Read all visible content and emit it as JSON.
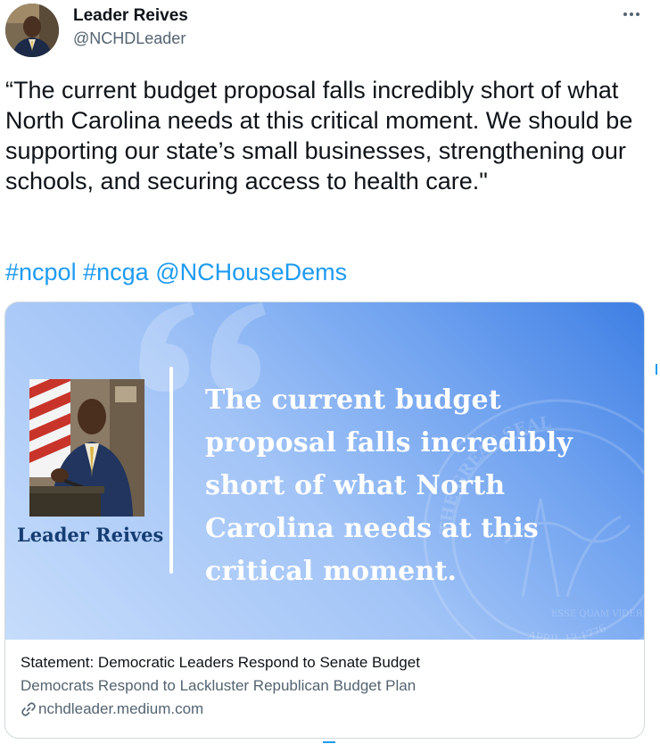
{
  "author": {
    "name": "Leader Reives",
    "handle": "@NCHDLeader",
    "avatar_icon": "profile-photo"
  },
  "menu": {
    "more_icon": "more-horizontal-icon"
  },
  "tweet": {
    "text": "“The current budget proposal falls incredibly short of what North Carolina needs at this critical moment. We should be supporting our state’s small businesses, strengthening our schools, and securing access to health care.\"",
    "hashtags": [
      "#ncpol",
      "#ncga",
      "@NCHouseDems"
    ],
    "link_color": "#1d9bf0"
  },
  "card": {
    "image": {
      "caption": "Leader Reives",
      "quote": "The current budget proposal falls incredibly short of what North Carolina needs at this critical moment.",
      "background_colors": [
        "#3e7fe4",
        "#c6dcfb"
      ],
      "caption_color": "#163d72",
      "seal_text_top": "THE GREAT SEAL",
      "seal_text_bottom": "APRIL 12 1776",
      "seal_text_motto": "ESSE QUAM VIDERI"
    },
    "title": "Statement: Democratic Leaders Respond to Senate Budget",
    "description": "Democrats Respond to Lackluster Republican Budget Plan",
    "domain": "nchdleader.medium.com",
    "domain_icon": "link-icon"
  }
}
